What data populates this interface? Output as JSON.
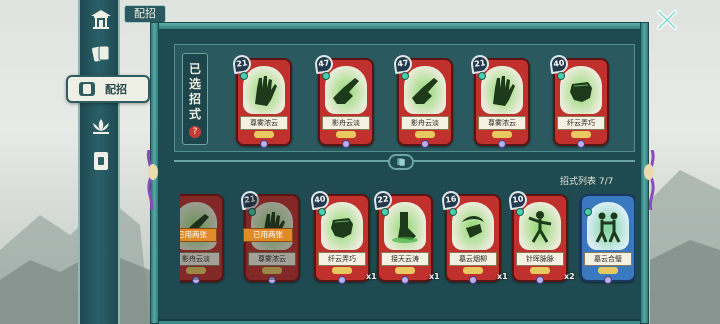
{
  "header": {
    "title": "配招"
  },
  "nav": {
    "items": [
      {
        "id": "home",
        "icon": "pavilion-icon"
      },
      {
        "id": "cards",
        "icon": "cards-icon"
      },
      {
        "id": "equip",
        "icon": "card-deck-icon",
        "label": "配招",
        "active": true
      },
      {
        "id": "skills",
        "icon": "lotus-icon"
      },
      {
        "id": "items",
        "icon": "dice-icon"
      }
    ]
  },
  "selected": {
    "label": [
      "已",
      "选",
      "招",
      "式"
    ],
    "help": "?",
    "cards": [
      {
        "cost": "21",
        "name": "尊雾浓云",
        "art": "palm"
      },
      {
        "cost": "47",
        "name": "影舟云淡",
        "art": "chop"
      },
      {
        "cost": "47",
        "name": "影舟云淡",
        "art": "chop"
      },
      {
        "cost": "21",
        "name": "尊雾浓云",
        "art": "palm"
      },
      {
        "cost": "40",
        "name": "纤云弄巧",
        "art": "fist"
      }
    ]
  },
  "list": {
    "header": "招式列表 7/7",
    "cards": [
      {
        "cost": "",
        "name": "影舟云淡",
        "used": "已用两张",
        "art": "chop",
        "count": ""
      },
      {
        "cost": "21",
        "name": "尊雾浓云",
        "used": "已用两张",
        "art": "palm",
        "count": ""
      },
      {
        "cost": "40",
        "name": "纤云弄巧",
        "used": "",
        "art": "fist",
        "count": "x1"
      },
      {
        "cost": "22",
        "name": "接天云涛",
        "used": "",
        "art": "kick",
        "count": "x1"
      },
      {
        "cost": "16",
        "name": "墓云烟柳",
        "used": "",
        "art": "spin",
        "count": "x1"
      },
      {
        "cost": "10",
        "name": "针晖脉脉",
        "used": "",
        "art": "pose",
        "count": "x2"
      },
      {
        "cost": "",
        "name": "墓云合璧",
        "used": "",
        "art": "duo",
        "count": "",
        "color": "blue"
      }
    ]
  },
  "colors": {
    "panel": "#1f4a51",
    "card": "#c0312e",
    "accent": "#3f8a8a"
  }
}
